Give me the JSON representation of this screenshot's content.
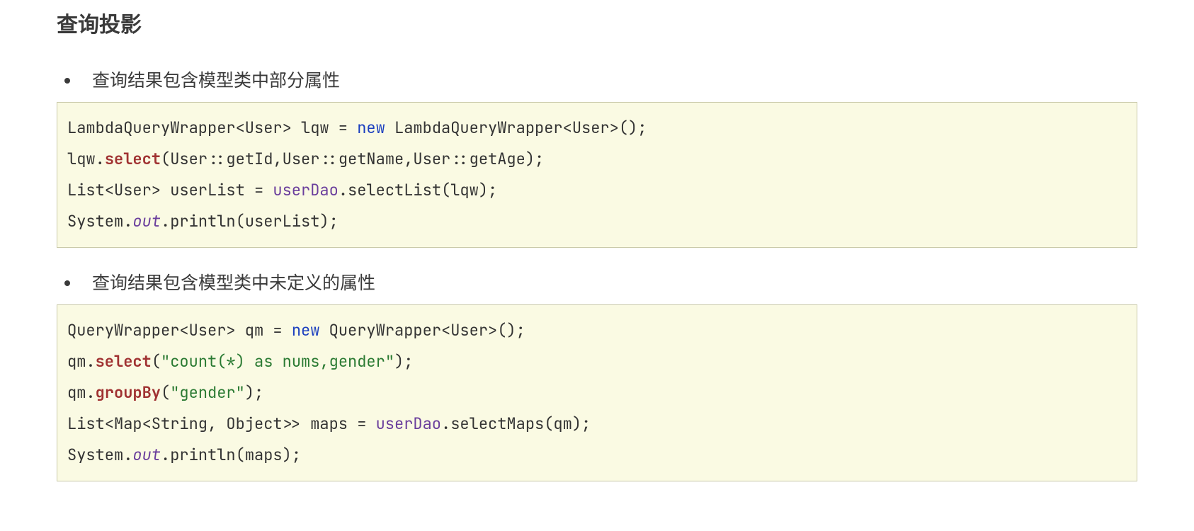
{
  "heading": "查询投影",
  "bullets": [
    "查询结果包含模型类中部分属性",
    "查询结果包含模型类中未定义的属性"
  ],
  "code1": {
    "l1a": "LambdaQueryWrapper<User> lqw = ",
    "l1_kw": "new",
    "l1b": " LambdaQueryWrapper<User>();",
    "l2a": "lqw.",
    "l2_m": "select",
    "l2b": "(User::getId,User::getName,User::getAge);",
    "l3a": "List<User> userList = ",
    "l3_id": "userDao",
    "l3b": ".selectList(lqw);",
    "l4a": "System.",
    "l4_st": "out",
    "l4b": ".println(userList);"
  },
  "code2": {
    "l1a": "QueryWrapper<User> qm = ",
    "l1_kw": "new",
    "l1b": " QueryWrapper<User>();",
    "l2a": "qm.",
    "l2_m": "select",
    "l2b1": "(",
    "l2_str": "\"count(*) as nums,gender\"",
    "l2b2": ");",
    "l3a": "qm.",
    "l3_m": "groupBy",
    "l3b1": "(",
    "l3_str": "\"gender\"",
    "l3b2": ");",
    "l4a": "List<Map<String, Object>> maps = ",
    "l4_id": "userDao",
    "l4b": ".selectMaps(qm);",
    "l5a": "System.",
    "l5_st": "out",
    "l5b": ".println(maps);"
  }
}
